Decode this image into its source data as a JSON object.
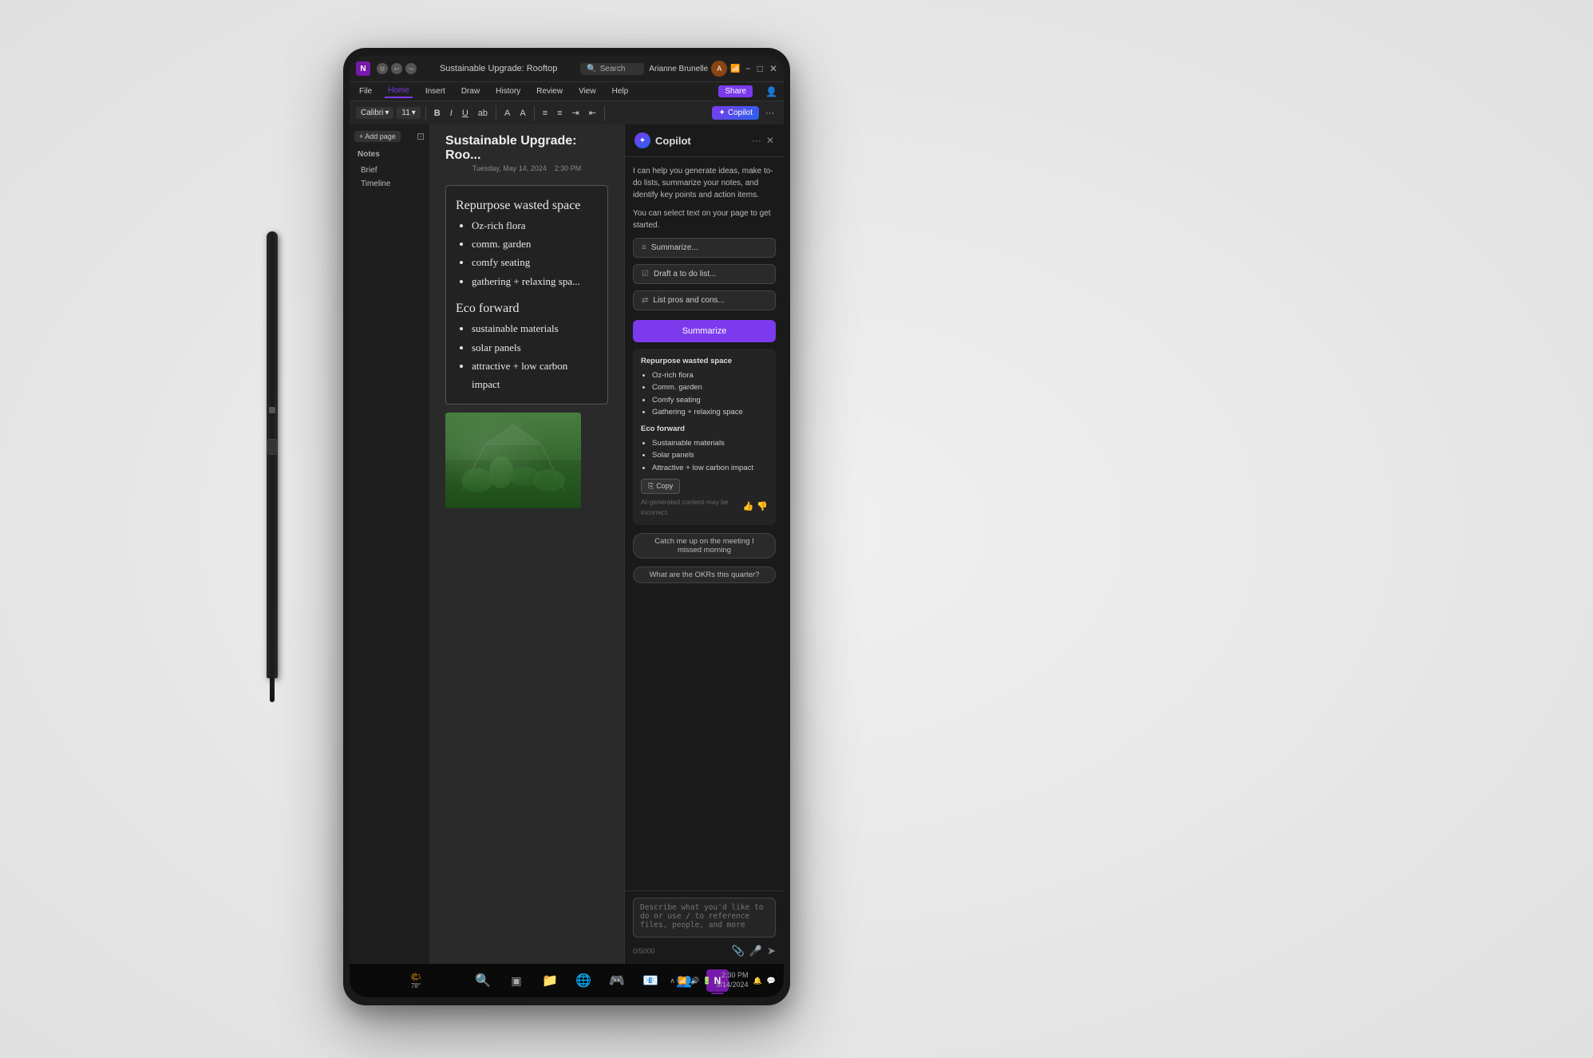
{
  "background": {
    "color": "#e8e8e8"
  },
  "titlebar": {
    "app_icon": "N",
    "title": "Sustainable Upgrade: Rooftop",
    "search_placeholder": "Search",
    "user_name": "Arianne Brunelle",
    "minimize": "−",
    "maximize": "□",
    "close": "✕"
  },
  "menubar": {
    "items": [
      "File",
      "Home",
      "Insert",
      "Draw",
      "History",
      "Review",
      "View",
      "Help"
    ],
    "active": "Home",
    "share_label": "Share"
  },
  "toolbar": {
    "font": "Calibri",
    "size": "11",
    "bold": "B",
    "italic": "I",
    "underline": "U",
    "copilot_label": "Copilot"
  },
  "sidebar": {
    "add_page": "+ Add page",
    "sections": [
      {
        "label": "Notes"
      },
      {
        "label": "Brief"
      },
      {
        "label": "Timeline"
      }
    ]
  },
  "note": {
    "title": "Sustainable Upgrade: Roo...",
    "date": "Tuesday, May 14, 2024",
    "time": "2:30 PM",
    "heading1": "Repurpose wasted space",
    "list1": [
      "Oz-rich flora",
      "comm. garden",
      "comfy seating",
      "gathering + relaxing spa..."
    ],
    "heading2": "Eco forward",
    "list2": [
      "sustainable materials",
      "solar panels",
      "attractive + low carbon impact"
    ]
  },
  "copilot": {
    "title": "Copilot",
    "intro": "I can help you generate ideas, make to-do lists, summarize your notes, and identify key points and action items.",
    "select_text": "You can select text on your page to get started.",
    "action_buttons": [
      {
        "label": "Summarize...",
        "icon": "≡"
      },
      {
        "label": "Draft a to do list...",
        "icon": "☑"
      },
      {
        "label": "List pros and cons...",
        "icon": "⇄"
      }
    ],
    "summarize_btn": "Summarize",
    "summary": {
      "section1_title": "Repurpose wasted space",
      "section1_items": [
        "Oz-rich flora",
        "Comm. garden",
        "Comfy seating",
        "Gathering + relaxing space"
      ],
      "section2_title": "Eco forward",
      "section2_items": [
        "Sustainable materials",
        "Solar panels",
        "Attractive + low carbon impact"
      ]
    },
    "copy_label": "Copy",
    "ai_disclaimer": "AI-generated content may be incorrect.",
    "suggestions": [
      "Catch me up on the meeting I missed morning",
      "What are the OKRs this quarter?"
    ],
    "input_placeholder": "Describe what you'd like to do or use / to reference files, people, and more",
    "char_count": "0/5000"
  },
  "taskbar": {
    "weather_temp": "78°",
    "time": "2:30 PM",
    "date": "5/14/2024",
    "icons": [
      "🌤",
      "⊞",
      "🔍",
      "▣",
      "📁",
      "🌐",
      "🎮",
      "📧",
      "👥",
      "N"
    ]
  }
}
